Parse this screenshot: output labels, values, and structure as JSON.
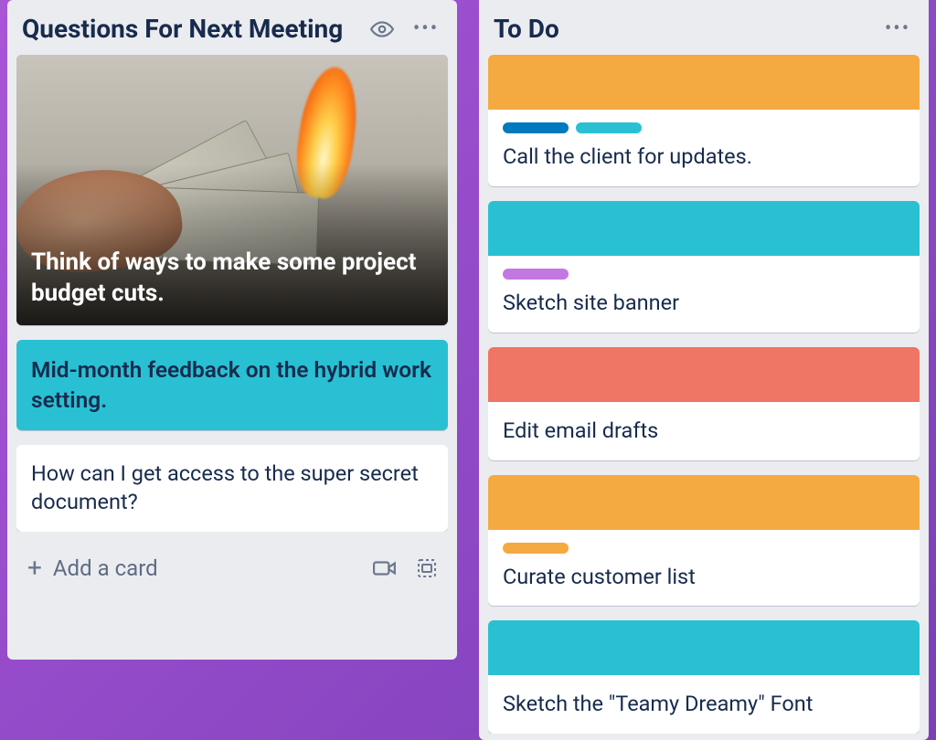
{
  "lists": [
    {
      "title": "Questions For Next Meeting",
      "watch_icon": "eye-icon",
      "menu_icon": "more-icon",
      "cards": [
        {
          "type": "image-cover",
          "title": "Think of ways to make some project budget cuts.",
          "image_alt": "burning money bills"
        },
        {
          "type": "full-color",
          "color": "teal",
          "title": "Mid-month feedback on the hybrid work setting."
        },
        {
          "type": "plain",
          "title": "How can I get access to the super secret document?"
        }
      ],
      "footer": {
        "add_label": "Add a card",
        "video_icon": "video-icon",
        "template_icon": "template-icon"
      }
    },
    {
      "title": "To Do",
      "menu_icon": "more-icon",
      "cards": [
        {
          "type": "cover-strip",
          "cover_color": "orange",
          "labels": [
            "blue",
            "teal"
          ],
          "title": "Call the client for updates."
        },
        {
          "type": "cover-strip",
          "cover_color": "teal",
          "labels": [
            "purple"
          ],
          "title": "Sketch site banner"
        },
        {
          "type": "cover-strip",
          "cover_color": "red",
          "labels": [],
          "title": "Edit email drafts"
        },
        {
          "type": "cover-strip",
          "cover_color": "orange",
          "labels": [
            "orange"
          ],
          "title": "Curate customer list"
        },
        {
          "type": "cover-strip",
          "cover_color": "teal",
          "labels": [],
          "title": "Sketch the \"Teamy Dreamy\" Font"
        }
      ]
    }
  ],
  "colors": {
    "orange": "#f5a941",
    "teal": "#29c0d3",
    "red": "#ef7564",
    "blue": "#0079bf",
    "purple": "#c377e0"
  }
}
